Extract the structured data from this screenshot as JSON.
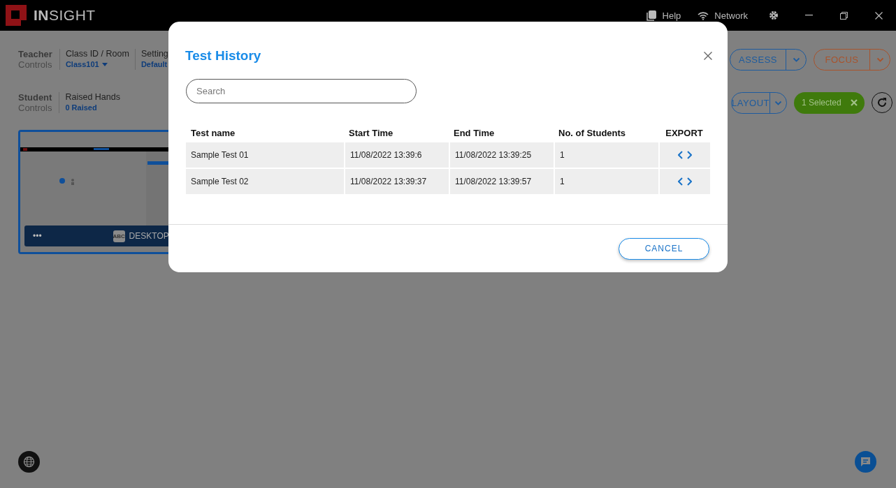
{
  "app": {
    "logo_bold": "IN",
    "logo_rest": "SIGHT"
  },
  "title_bar": {
    "items": [
      {
        "kind": "help",
        "label": "Help"
      },
      {
        "kind": "network",
        "label": "Network"
      }
    ]
  },
  "teacher_controls": {
    "heading": "Teacher",
    "subheading": "Controls",
    "fields": [
      {
        "label": "Class ID / Room",
        "value": "Class101",
        "dropdown": true
      },
      {
        "label": "Setting",
        "value": "Default",
        "dropdown": false
      }
    ],
    "buttons": [
      {
        "label": "ASSESS",
        "color": "#1d5b9e"
      },
      {
        "label": "FOCUS",
        "color": "#a8532c"
      }
    ]
  },
  "student_controls": {
    "heading": "Student",
    "subheading": "Controls",
    "fields": [
      {
        "label": "Raised Hands",
        "value": "0 Raised",
        "dropdown": false
      }
    ],
    "layout_button": "LAYOUT",
    "selection": "1 Selected"
  },
  "student_tile": {
    "selected": true,
    "menu": "•••",
    "badge": "ABC",
    "name": "DESKTOP"
  },
  "dialog": {
    "title": "Test History",
    "search": {
      "placeholder": "Search"
    },
    "columns": [
      "Test name",
      "Start Time",
      "End Time",
      "No. of Students",
      "EXPORT"
    ],
    "rows": [
      {
        "cells": [
          "Sample Test 01",
          "11/08/2022 13:39:6",
          "11/08/2022 13:39:25",
          "1"
        ]
      },
      {
        "cells": [
          "Sample Test 02",
          "11/08/2022 13:39:37",
          "11/08/2022 13:39:57",
          "1"
        ]
      }
    ],
    "cancel": "CANCEL"
  }
}
